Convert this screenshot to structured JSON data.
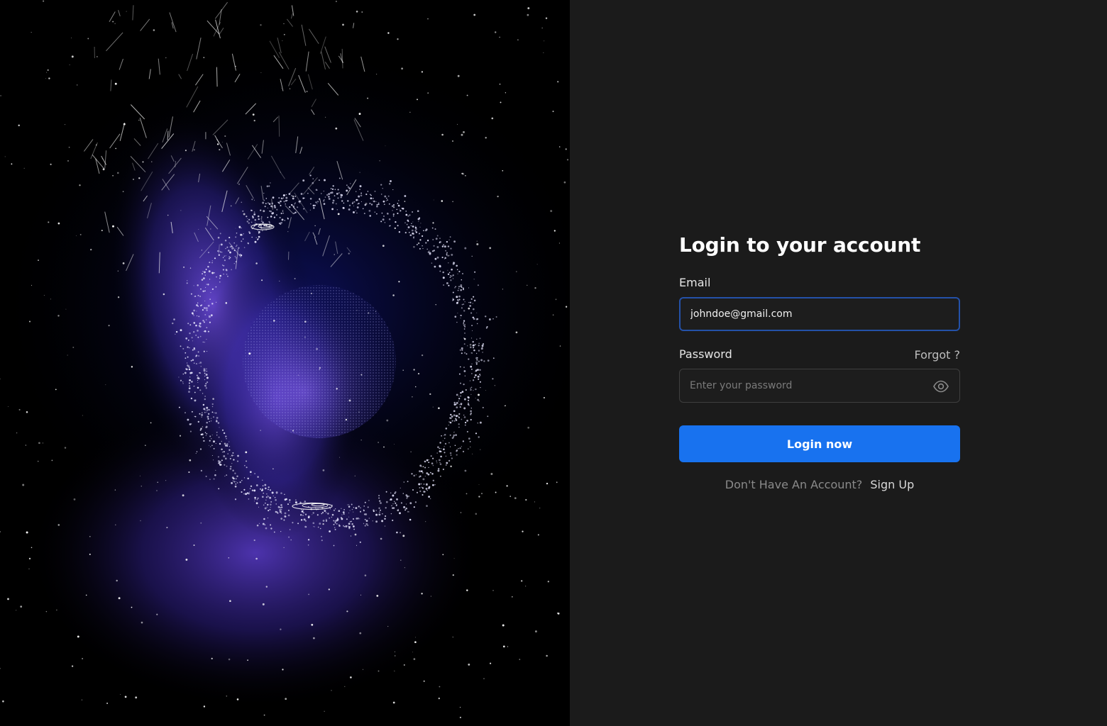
{
  "login": {
    "title": "Login to your account",
    "email_label": "Email",
    "email_value": "johndoe@gmail.com",
    "password_label": "Password",
    "forgot_label": "Forgot ?",
    "password_placeholder": "Enter your password",
    "submit_label": "Login now",
    "signup_question": "Don't Have An Account?",
    "signup_link": "Sign Up"
  },
  "icons": {
    "password_toggle": "eye-icon"
  },
  "colors": {
    "primary": "#1872ef",
    "panel_bg": "#1b1b1b",
    "focus_border": "#2451a8",
    "nebula": "#5b3fc4",
    "hero_bg": "#000000"
  }
}
